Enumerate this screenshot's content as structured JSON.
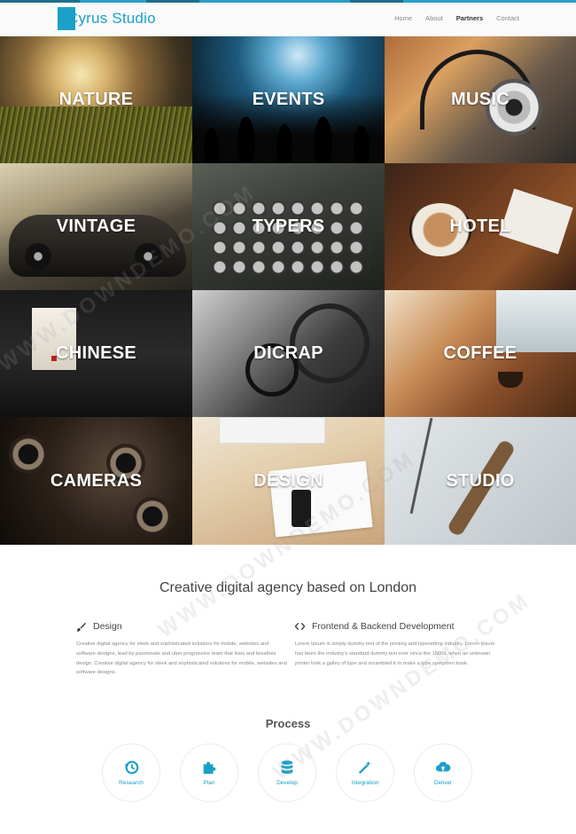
{
  "brand": {
    "name": "Cyrus Studio",
    "accent_color": "#1ba0c8"
  },
  "nav": {
    "items": [
      {
        "label": "Home",
        "active": false
      },
      {
        "label": "About",
        "active": false
      },
      {
        "label": "Partners",
        "active": true
      },
      {
        "label": "Contact",
        "active": false
      }
    ]
  },
  "tiles": [
    {
      "label": "NATURE"
    },
    {
      "label": "EVENTS"
    },
    {
      "label": "MUSIC"
    },
    {
      "label": "VINTAGE"
    },
    {
      "label": "TYPERS"
    },
    {
      "label": "HOTEL"
    },
    {
      "label": "CHINESE"
    },
    {
      "label": "DICRAP"
    },
    {
      "label": "COFFEE"
    },
    {
      "label": "CAMERAS"
    },
    {
      "label": "DESIGN"
    },
    {
      "label": "STUDIO"
    }
  ],
  "about": {
    "title": "Creative digital agency based on London",
    "features": [
      {
        "icon": "brush-icon",
        "title": "Design",
        "text": "Creative digital agency for sleek and sophisticated solutions for mobile, websites and software designs, lead by passionate and uber progressive team that lives and breathes design. Creative digital agency for sleek and sophisticated solutions for mobile, websites and software designs."
      },
      {
        "icon": "code-icon",
        "title": "Frontend & Backend Development",
        "text": "Lorem Ipsum is simply dummy text of the printing and typesetting industry. Lorem Ipsum has been the industry's standard dummy text ever since the 1500s, when an unknown printer took a galley of type and scrambled it to make a type specimen book."
      }
    ]
  },
  "process": {
    "title": "Process",
    "steps": [
      {
        "label": "Research",
        "icon": "history-icon"
      },
      {
        "label": "Plan",
        "icon": "puzzle-icon"
      },
      {
        "label": "Develop",
        "icon": "database-icon"
      },
      {
        "label": "Integration",
        "icon": "magic-wand-icon"
      },
      {
        "label": "Deliver",
        "icon": "cloud-upload-icon"
      }
    ]
  },
  "watermark": "WWW.DOWNDEMO.COM"
}
